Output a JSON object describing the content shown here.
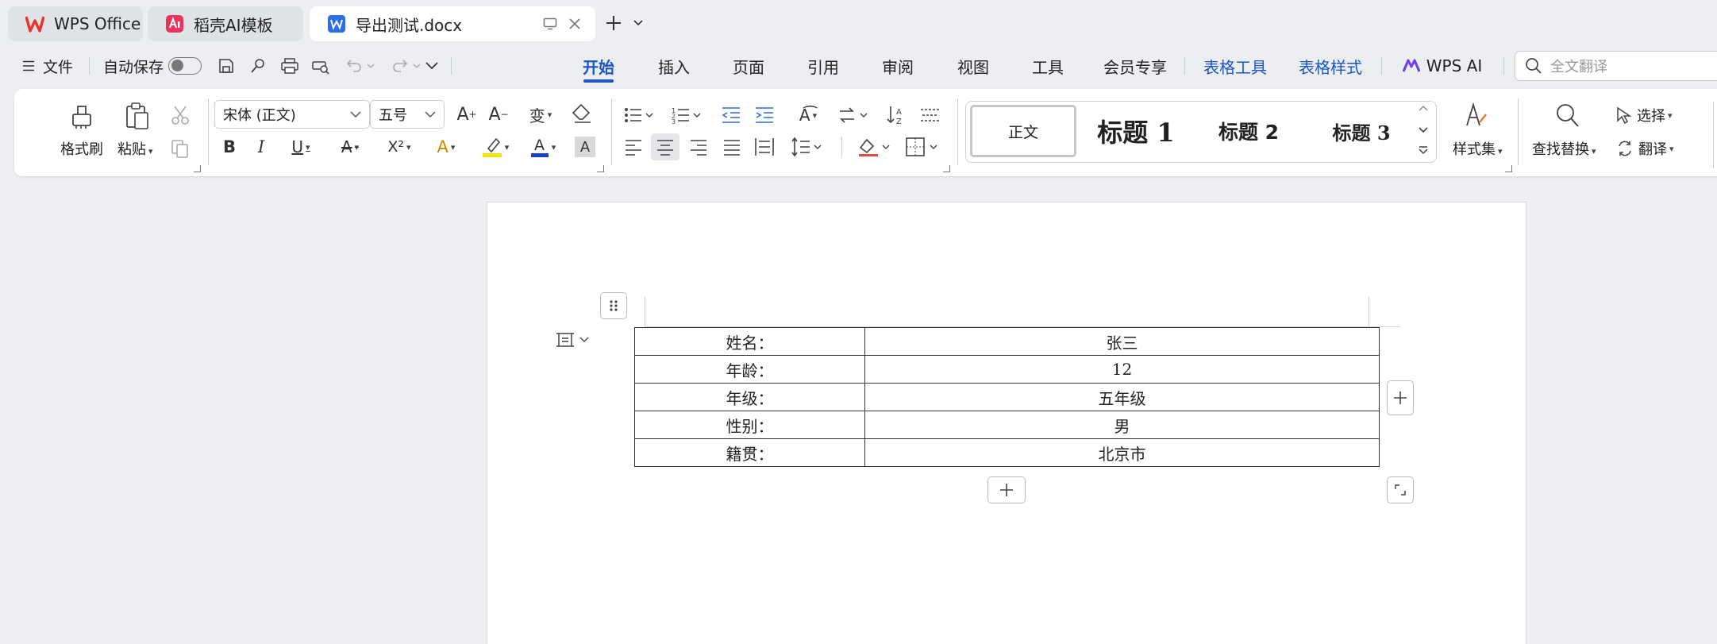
{
  "tabs": [
    {
      "label": "WPS Office",
      "icon": "wps-logo-icon",
      "state": "inactive"
    },
    {
      "label": "稻壳AI模板",
      "icon": "docer-ai-icon",
      "state": "inactive"
    },
    {
      "label": "导出测试.docx",
      "icon": "word-doc-icon",
      "state": "active"
    }
  ],
  "menu": {
    "file_label": "文件",
    "autosave_label": "自动保存",
    "autosave_on": false,
    "tabs": [
      "开始",
      "插入",
      "页面",
      "引用",
      "审阅",
      "视图",
      "工具",
      "会员专享",
      "表格工具",
      "表格样式",
      "WPS AI"
    ],
    "active_tab": "开始",
    "search_placeholder": "全文翻译"
  },
  "ribbon": {
    "format_painter": "格式刷",
    "paste": "粘贴",
    "font_name": "宋体 (正文)",
    "font_size": "五号",
    "styles": [
      "正文",
      "标题 1",
      "标题 2",
      "标题 3"
    ],
    "style_set": "样式集",
    "find_replace": "查找替换",
    "select": "选择",
    "translate": "翻译"
  },
  "document": {
    "table": [
      {
        "label": "姓名：",
        "value": "张三"
      },
      {
        "label": "年龄：",
        "value": "12"
      },
      {
        "label": "年级：",
        "value": "五年级"
      },
      {
        "label": "性别：",
        "value": "男"
      },
      {
        "label": "籍贯：",
        "value": "北京市"
      }
    ]
  },
  "colors": {
    "accent": "#1a56c8",
    "highlight": "#f5e400",
    "font_color": "#1a3fd0",
    "wps_red": "#e8342a"
  }
}
